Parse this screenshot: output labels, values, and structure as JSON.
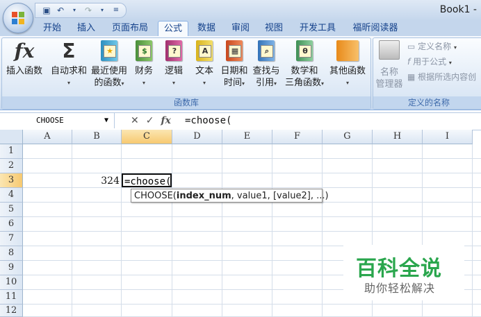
{
  "window": {
    "title": "Book1 -"
  },
  "ribbon": {
    "tabs": [
      {
        "label": "开始"
      },
      {
        "label": "插入"
      },
      {
        "label": "页面布局"
      },
      {
        "label": "公式"
      },
      {
        "label": "数据"
      },
      {
        "label": "审阅"
      },
      {
        "label": "视图"
      },
      {
        "label": "开发工具"
      },
      {
        "label": "福昕阅读器"
      }
    ],
    "active_tab": "公式",
    "function_library": {
      "group_label": "函数库",
      "insert_function": "插入函数",
      "autosum": "自动求和",
      "recent_line1": "最近使用",
      "recent_line2": "的函数",
      "financial": "财务",
      "logical": "逻辑",
      "text": "文本",
      "datetime_line1": "日期和",
      "datetime_line2": "时间",
      "lookup_line1": "查找与",
      "lookup_line2": "引用",
      "math_line1": "数学和",
      "math_line2": "三角函数",
      "other": "其他函数",
      "fx_glyph": "fx",
      "sigma_glyph": "Σ",
      "logical_glyph": "?",
      "text_glyph": "A",
      "math_glyph": "θ"
    },
    "defined_names": {
      "group_label": "定义的名称",
      "name_manager_line1": "名称",
      "name_manager_line2": "管理器",
      "define_name": "定义名称",
      "use_in_formula": "用于公式",
      "create_from_selection": "根据所选内容创"
    }
  },
  "formula_bar": {
    "name_box": "CHOOSE",
    "cancel_glyph": "✕",
    "enter_glyph": "✓",
    "fx_glyph": "fx",
    "formula": "=choose("
  },
  "sheet": {
    "columns": [
      "A",
      "B",
      "C",
      "D",
      "E",
      "F",
      "G",
      "H",
      "I"
    ],
    "rows": [
      "1",
      "2",
      "3",
      "4",
      "5",
      "6",
      "7",
      "8",
      "9",
      "10",
      "11",
      "12"
    ],
    "selected_column": "C",
    "selected_row": "3",
    "cells": {
      "B3": "324",
      "C3": "=choose("
    },
    "tooltip": {
      "fn": "CHOOSE(",
      "arg_bold": "index_num",
      "rest": ", value1, [value2], ...)"
    }
  },
  "watermark": {
    "title": "百科全说",
    "subtitle": "助你轻松解决"
  },
  "colors": {
    "accent": "#15428b",
    "watermark_green": "#2aa64d",
    "selected_header": "#f7c970"
  }
}
